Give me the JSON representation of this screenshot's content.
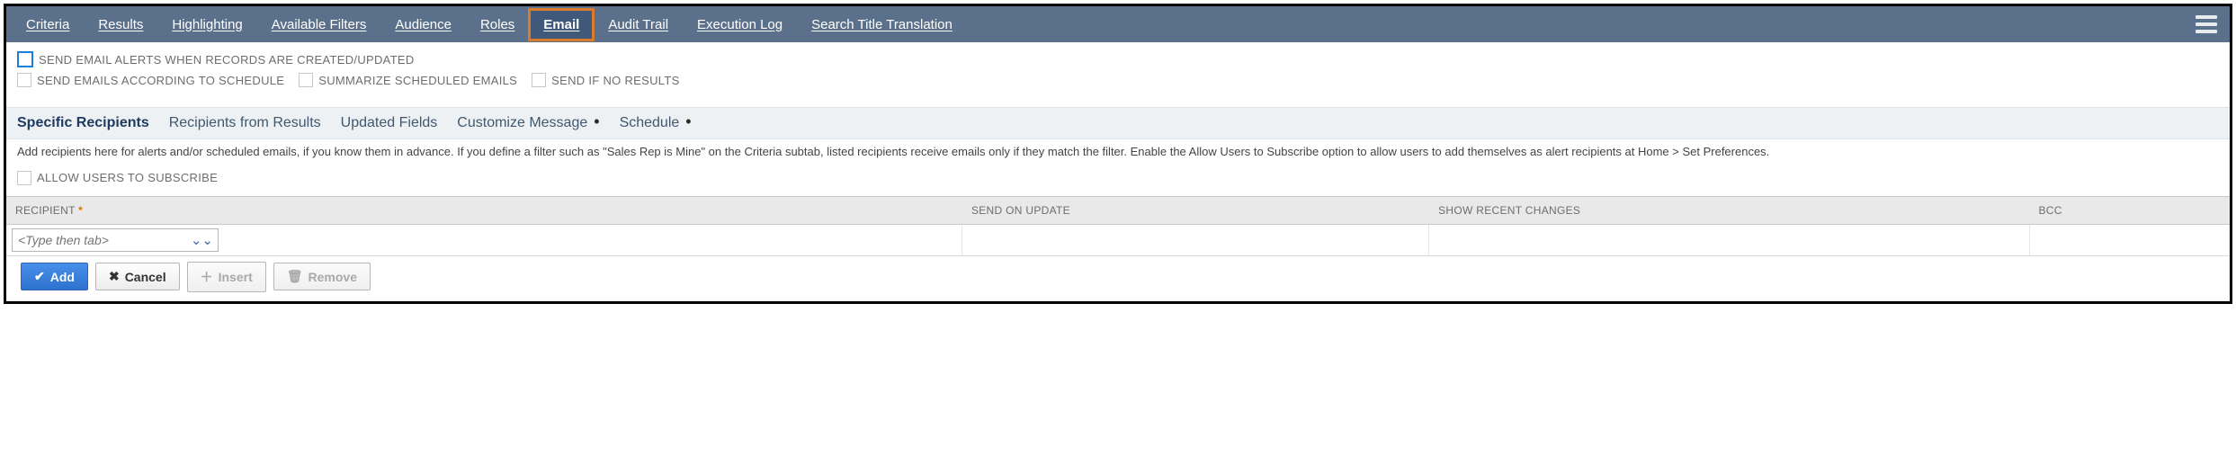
{
  "topnav": {
    "tabs": [
      {
        "label": "Criteria"
      },
      {
        "label": "Results"
      },
      {
        "label": "Highlighting"
      },
      {
        "label": "Available Filters"
      },
      {
        "label": "Audience"
      },
      {
        "label": "Roles"
      },
      {
        "label": "Email",
        "active": true
      },
      {
        "label": "Audit Trail"
      },
      {
        "label": "Execution Log"
      },
      {
        "label": "Search Title Translation"
      }
    ]
  },
  "options": {
    "send_alerts_label": "SEND EMAIL ALERTS WHEN RECORDS ARE CREATED/UPDATED",
    "send_schedule_label": "SEND EMAILS ACCORDING TO SCHEDULE",
    "summarize_label": "SUMMARIZE SCHEDULED EMAILS",
    "send_if_no_results_label": "SEND IF NO RESULTS"
  },
  "subtabs": {
    "items": [
      {
        "label": "Specific Recipients",
        "active": true
      },
      {
        "label": "Recipients from Results"
      },
      {
        "label": "Updated Fields"
      },
      {
        "label": "Customize Message",
        "dot": true
      },
      {
        "label": "Schedule",
        "dot": true
      }
    ]
  },
  "helptext": "Add recipients here for alerts and/or scheduled emails, if you know them in advance. If you define a filter such as \"Sales Rep is Mine\" on the Criteria subtab, listed recipients receive emails only if they match the filter. Enable the Allow Users to Subscribe option to allow users to add themselves as alert recipients at Home > Set Preferences.",
  "allow_subscribe_label": "ALLOW USERS TO SUBSCRIBE",
  "table": {
    "headers": {
      "recipient": "RECIPIENT",
      "send_on_update": "SEND ON UPDATE",
      "show_recent_changes": "SHOW RECENT CHANGES",
      "bcc": "BCC"
    },
    "recipient_placeholder": "<Type then tab>"
  },
  "buttons": {
    "add": "Add",
    "cancel": "Cancel",
    "insert": "Insert",
    "remove": "Remove"
  }
}
